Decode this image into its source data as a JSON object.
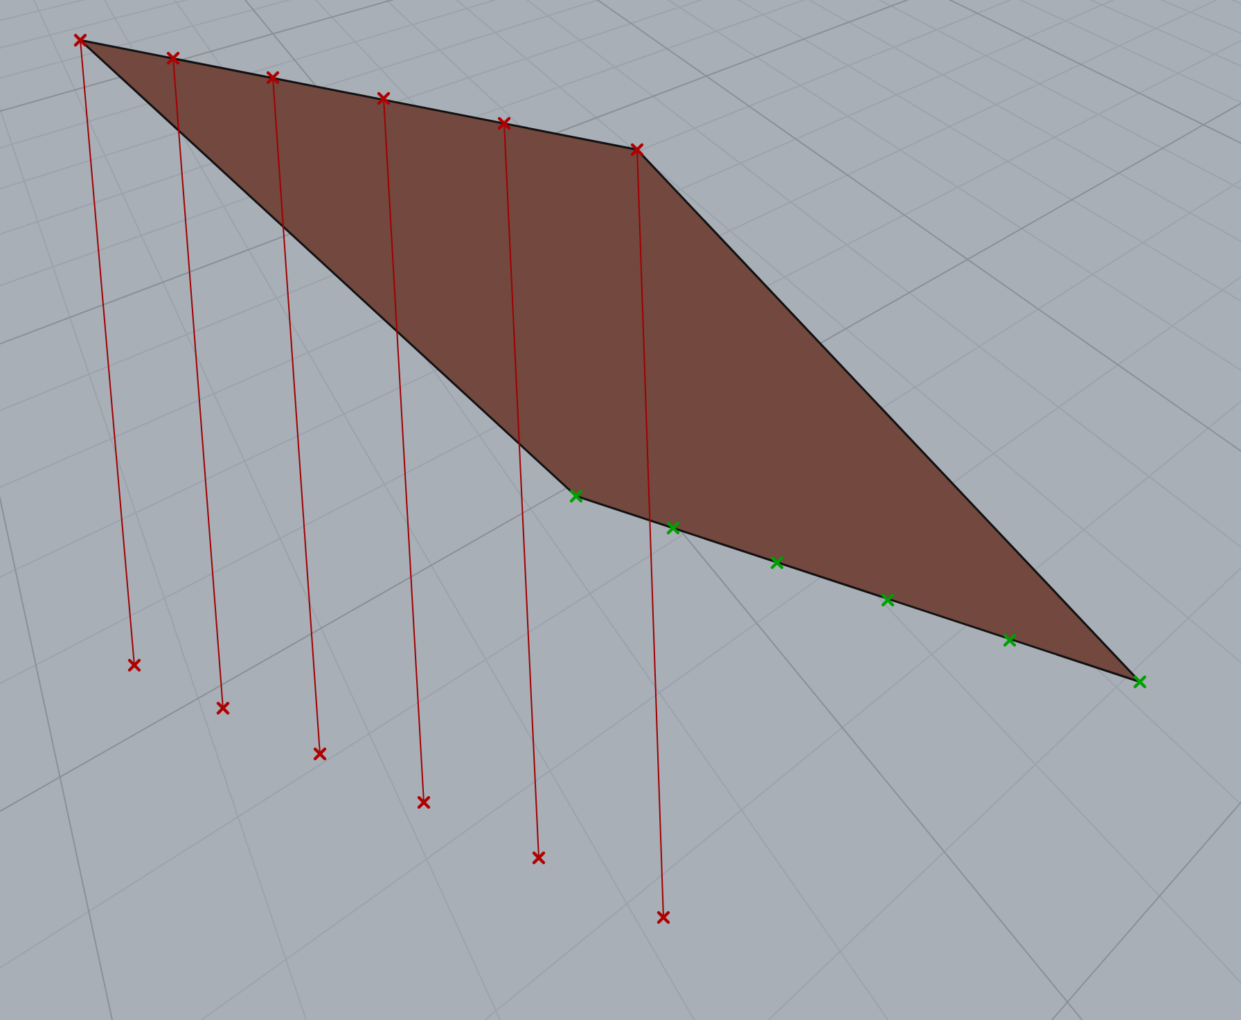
{
  "viewport": {
    "markers": [
      {
        "kind": "top",
        "color": "#b00000"
      },
      {
        "kind": "top",
        "color": "#b00000"
      },
      {
        "kind": "top",
        "color": "#b00000"
      },
      {
        "kind": "top",
        "color": "#b00000"
      },
      {
        "kind": "top",
        "color": "#b00000"
      },
      {
        "kind": "top",
        "color": "#b00000"
      },
      {
        "kind": "base",
        "color": "#b00000"
      },
      {
        "kind": "base",
        "color": "#b00000"
      },
      {
        "kind": "base",
        "color": "#b00000"
      },
      {
        "kind": "base",
        "color": "#b00000"
      },
      {
        "kind": "base",
        "color": "#b00000"
      },
      {
        "kind": "base",
        "color": "#b00000"
      },
      {
        "kind": "edge",
        "color": "#00a000"
      },
      {
        "kind": "edge",
        "color": "#00a000"
      },
      {
        "kind": "edge",
        "color": "#00a000"
      },
      {
        "kind": "edge",
        "color": "#00a000"
      },
      {
        "kind": "edge",
        "color": "#00a000"
      },
      {
        "kind": "edge",
        "color": "#00a000"
      }
    ]
  }
}
